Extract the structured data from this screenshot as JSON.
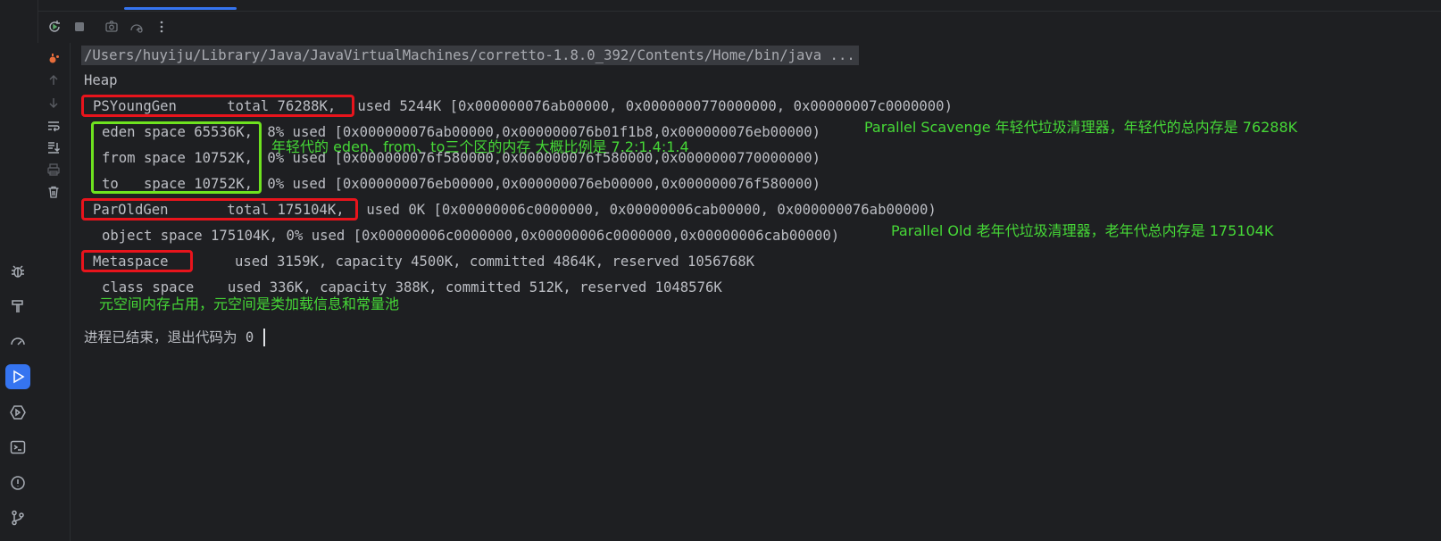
{
  "colors": {
    "annotation_green": "#46d837",
    "box_red": "#e8141c",
    "box_green": "#6ee21f",
    "active_blue": "#3574f0",
    "console_text": "#bcbec4"
  },
  "left_strip": {
    "icons": [
      "bug-icon",
      "build-hammer-icon",
      "profiler-gauge-icon",
      "run-icon",
      "services-icon",
      "terminal-icon",
      "problems-icon",
      "git-branch-icon"
    ]
  },
  "run_toolbar": {
    "icons": [
      "rerun-icon",
      "stop-icon",
      "screenshot-icon",
      "coverage-icon",
      "more-options-icon"
    ]
  },
  "console_side": {
    "icons": [
      "debug-orange-icon",
      "scroll-up-icon",
      "scroll-down-icon",
      "soft-wrap-icon",
      "scroll-to-end-icon",
      "print-icon",
      "clear-trash-icon"
    ]
  },
  "console": {
    "command": "/Users/huyiju/Library/Java/JavaVirtualMachines/corretto-1.8.0_392/Contents/Home/bin/java ...",
    "heap": "Heap",
    "young_label": "PSYoungGen      total 76288K,",
    "young_rest": " used 5244K [0x000000076ab00000, 0x0000000770000000, 0x00000007c0000000)",
    "eden_label": "eden space 65536K,",
    "eden_rest": " 8% used [0x000000076ab00000,0x000000076b01f1b8,0x000000076eb00000)",
    "from_label": "from space 10752K,",
    "from_rest": " 0% used [0x000000076f580000,0x000000076f580000,0x0000000770000000)",
    "to_label": "to   space 10752K,",
    "to_rest": " 0% used [0x000000076eb00000,0x000000076eb00000,0x000000076f580000)",
    "old_label": "ParOldGen       total 175104K,",
    "old_rest": " used 0K [0x00000006c0000000, 0x00000006cab00000, 0x000000076ab00000)",
    "object_space": "object space 175104K, 0% used [0x00000006c0000000,0x00000006c0000000,0x00000006cab00000)",
    "meta_label": "Metaspace",
    "meta_rest": "used 3159K, capacity 4500K, committed 4864K, reserved 1056768K",
    "class_space": "class space    used 336K, capacity 388K, committed 512K, reserved 1048576K",
    "exit_message": "进程已结束，退出代码为 0"
  },
  "annotations": {
    "young": "Parallel Scavenge 年轻代垃圾清理器，年轻代的总内存是 76288K",
    "regions": "年轻代的 eden、from、to三个区的内存 大概比例是 7.2:1.4:1.4",
    "old": "Parallel Old 老年代垃圾清理器，老年代总内存是 175104K",
    "meta": "元空间内存占用，元空间是类加载信息和常量池"
  }
}
